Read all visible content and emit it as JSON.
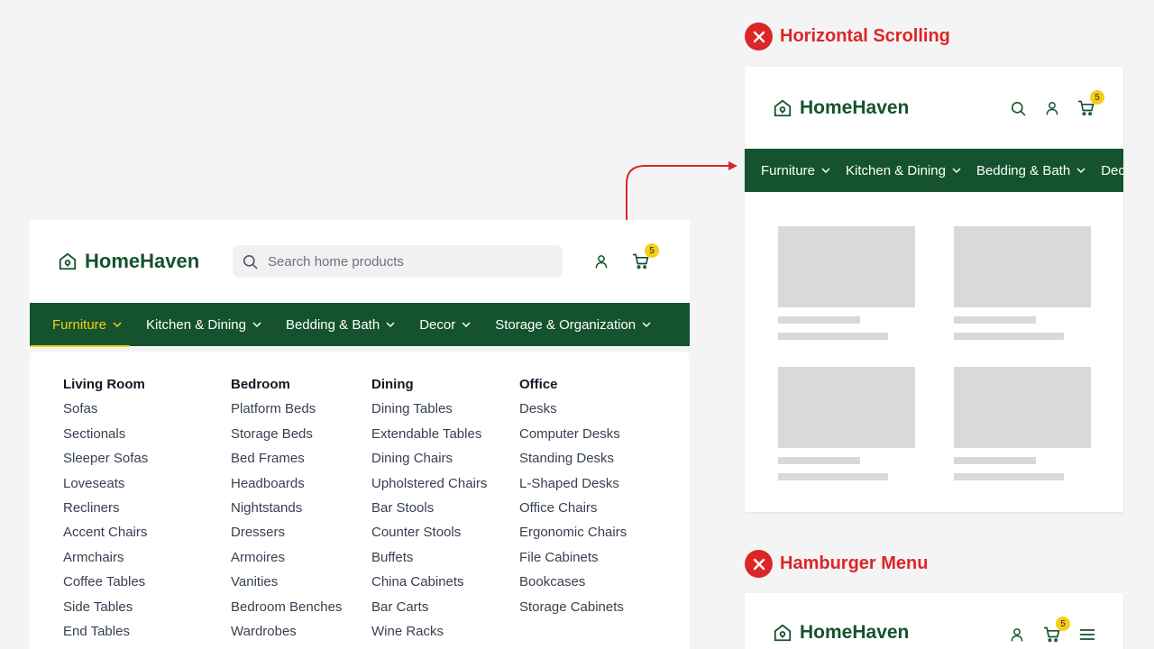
{
  "brand": {
    "name": "HomeHaven",
    "primary_color": "#14532d",
    "accent_color": "#facc15",
    "error_color": "#dc2626"
  },
  "desktop": {
    "search_placeholder": "Search home products",
    "cart_count": "5",
    "nav": [
      {
        "label": "Furniture",
        "active": true
      },
      {
        "label": "Kitchen & Dining"
      },
      {
        "label": "Bedding & Bath"
      },
      {
        "label": "Decor"
      },
      {
        "label": "Storage & Organization"
      }
    ],
    "mega_menu": [
      {
        "heading": "Living Room",
        "items": [
          "Sofas",
          "Sectionals",
          "Sleeper Sofas",
          "Loveseats",
          "Recliners",
          "Accent Chairs",
          "Armchairs",
          "Coffee Tables",
          "Side Tables",
          "End Tables"
        ]
      },
      {
        "heading": "Bedroom",
        "items": [
          "Platform Beds",
          "Storage Beds",
          "Bed Frames",
          "Headboards",
          "Nightstands",
          "Dressers",
          "Armoires",
          "Vanities",
          "Bedroom Benches",
          "Wardrobes"
        ]
      },
      {
        "heading": "Dining",
        "items": [
          "Dining Tables",
          "Extendable Tables",
          "Dining Chairs",
          "Upholstered Chairs",
          "Bar Stools",
          "Counter Stools",
          "Buffets",
          "China Cabinets",
          "Bar Carts",
          "Wine Racks"
        ]
      },
      {
        "heading": "Office",
        "items": [
          "Desks",
          "Computer Desks",
          "Standing Desks",
          "L-Shaped Desks",
          "Office Chairs",
          "Ergonomic Chairs",
          "File Cabinets",
          "Bookcases",
          "Storage Cabinets"
        ]
      }
    ]
  },
  "examples": [
    {
      "title": "Horizontal Scrolling",
      "cart_count": "5",
      "nav": [
        "Furniture",
        "Kitchen & Dining",
        "Bedding & Bath",
        "Decor"
      ]
    },
    {
      "title": "Hamburger Menu",
      "cart_count": "5"
    }
  ],
  "icons": [
    "house-logo-icon",
    "search-icon",
    "user-icon",
    "cart-icon",
    "chevron-down-icon",
    "close-x-icon",
    "menu-icon",
    "arrow-icon"
  ]
}
